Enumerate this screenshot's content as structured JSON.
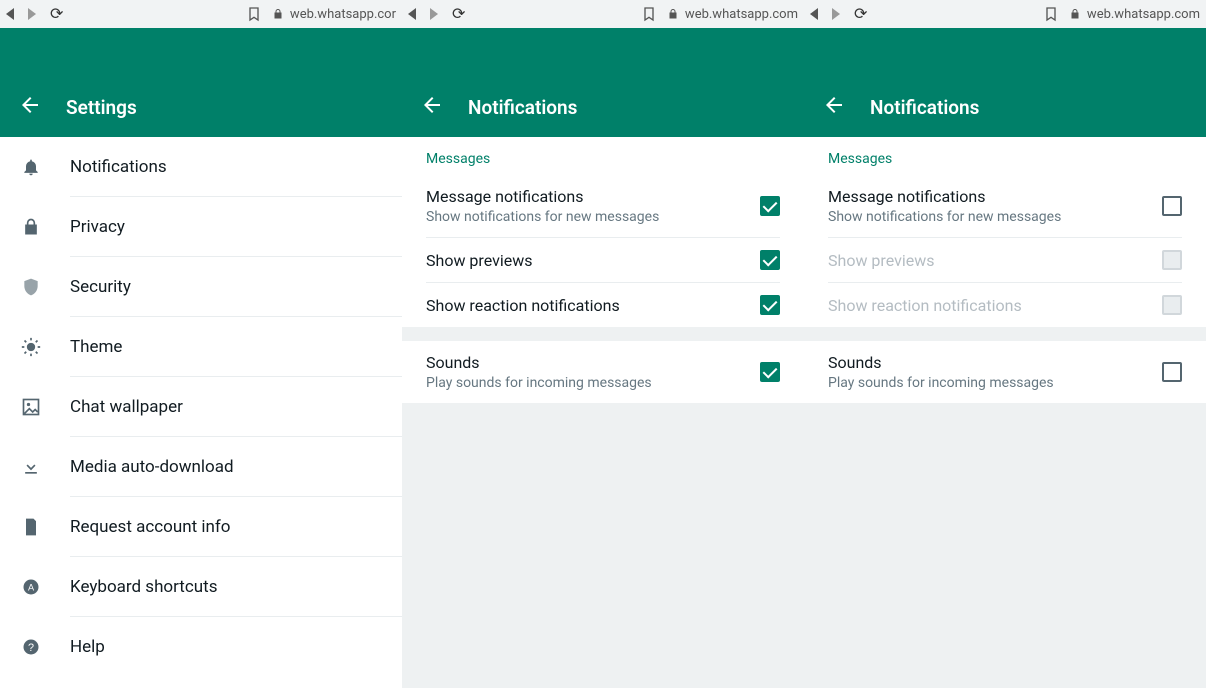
{
  "browser": {
    "url_short": "web.whatsapp.cor",
    "url_full": "web.whatsapp.com"
  },
  "pane1": {
    "header_title": "Settings",
    "items": [
      {
        "key": "notifications",
        "label": "Notifications"
      },
      {
        "key": "privacy",
        "label": "Privacy"
      },
      {
        "key": "security",
        "label": "Security"
      },
      {
        "key": "theme",
        "label": "Theme"
      },
      {
        "key": "chat-wallpaper",
        "label": "Chat wallpaper"
      },
      {
        "key": "media-download",
        "label": "Media auto-download"
      },
      {
        "key": "request-info",
        "label": "Request account info"
      },
      {
        "key": "keyboard",
        "label": "Keyboard shortcuts"
      },
      {
        "key": "help",
        "label": "Help"
      }
    ]
  },
  "pane2": {
    "header_title": "Notifications",
    "section_messages": "Messages",
    "rows": {
      "msg_notif": {
        "title": "Message notifications",
        "sub": "Show notifications for new messages",
        "checked": true
      },
      "previews": {
        "title": "Show previews",
        "checked": true
      },
      "reactions": {
        "title": "Show reaction notifications",
        "checked": true
      },
      "sounds": {
        "title": "Sounds",
        "sub": "Play sounds for incoming messages",
        "checked": true
      }
    }
  },
  "pane3": {
    "header_title": "Notifications",
    "section_messages": "Messages",
    "rows": {
      "msg_notif": {
        "title": "Message notifications",
        "sub": "Show notifications for new messages",
        "checked": false,
        "disabled": false
      },
      "previews": {
        "title": "Show previews",
        "checked": false,
        "disabled": true
      },
      "reactions": {
        "title": "Show reaction notifications",
        "checked": false,
        "disabled": true
      },
      "sounds": {
        "title": "Sounds",
        "sub": "Play sounds for incoming messages",
        "checked": false,
        "disabled": false
      }
    }
  }
}
